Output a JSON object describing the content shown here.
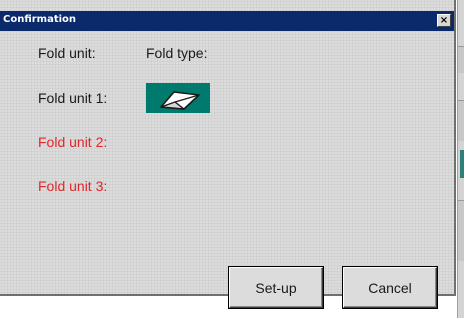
{
  "window": {
    "title": "Confirmation",
    "close_glyph": "×"
  },
  "headers": {
    "unit": "Fold unit:",
    "type": "Fold type:"
  },
  "units": [
    {
      "label": "Fold unit 1:",
      "color": "#1a1a1a",
      "fold_icon": "letter-fold-icon"
    },
    {
      "label": "Fold unit 2:",
      "color": "#e3262b"
    },
    {
      "label": "Fold unit 3:",
      "color": "#e3262b"
    }
  ],
  "buttons": {
    "setup": "Set-up",
    "cancel": "Cancel"
  },
  "colors": {
    "titlebar": "#0a2a6b",
    "icon_bg": "#007a6c",
    "inactive_red": "#e3262b"
  }
}
